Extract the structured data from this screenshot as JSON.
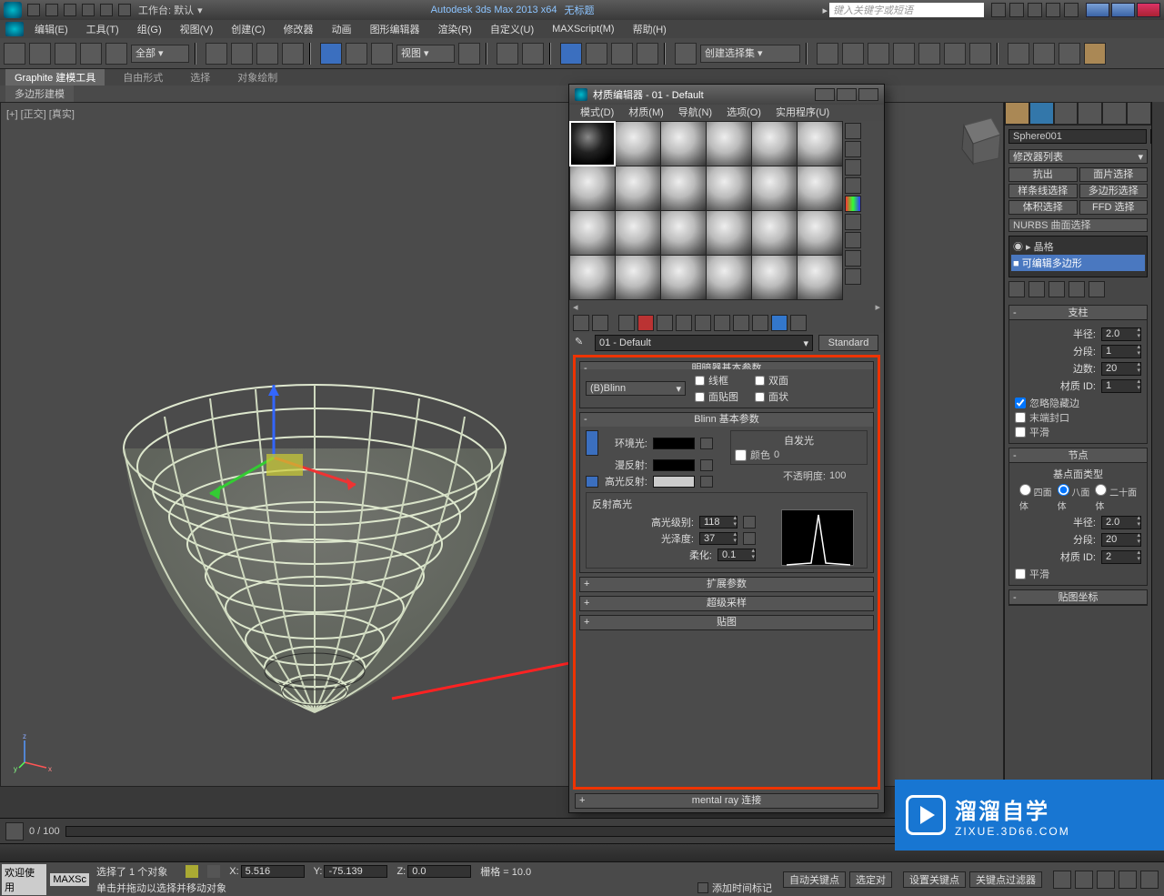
{
  "titlebar": {
    "workspace_label": "工作台: 默认",
    "app_title": "Autodesk 3ds Max  2013 x64",
    "doc_title": "无标题",
    "search_placeholder": "键入关键字或短语"
  },
  "menubar": {
    "items": [
      "编辑(E)",
      "工具(T)",
      "组(G)",
      "视图(V)",
      "创建(C)",
      "修改器",
      "动画",
      "图形编辑器",
      "渲染(R)",
      "自定义(U)",
      "MAXScript(M)",
      "帮助(H)"
    ]
  },
  "toolbar": {
    "selection_set": "全部",
    "view_name": "视图",
    "named_sel": "创建选择集"
  },
  "ribbon": {
    "tabs": [
      "Graphite 建模工具",
      "自由形式",
      "选择",
      "对象绘制"
    ],
    "sub": "多边形建模"
  },
  "viewport": {
    "label": "[+] [正交] [真实]"
  },
  "material_editor": {
    "title": "材质编辑器 - 01 - Default",
    "menu": [
      "模式(D)",
      "材质(M)",
      "导航(N)",
      "选项(O)",
      "实用程序(U)"
    ],
    "mat_name": "01 - Default",
    "type_btn": "Standard",
    "rollout_shader_title": "明暗器基本参数",
    "shader_name": "(B)Blinn",
    "checks": {
      "wire": "线框",
      "twoSided": "双面",
      "faceMap": "面贴图",
      "faceted": "面状"
    },
    "rollout_blinn_title": "Blinn 基本参数",
    "labels": {
      "ambient": "环境光:",
      "diffuse": "漫反射:",
      "specular": "高光反射:",
      "selfillum_group": "自发光",
      "selfillum_color": "颜色",
      "selfillum_val": "0",
      "opacity": "不透明度:",
      "opacity_val": "100"
    },
    "spec_group": "反射高光",
    "spec": {
      "level_lbl": "高光级别:",
      "level_val": "118",
      "gloss_lbl": "光泽度:",
      "gloss_val": "37",
      "soften_lbl": "柔化:",
      "soften_val": "0.1"
    },
    "rollout_extended": "扩展参数",
    "rollout_supersample": "超级采样",
    "rollout_maps": "贴图",
    "rollout_mentalray": "mental ray 连接"
  },
  "modify_panel": {
    "obj_name": "Sphere001",
    "modifier_list": "修改器列表",
    "btns": [
      "抗出",
      "面片选择",
      "样条线选择",
      "多边形选择",
      "体积选择",
      "FFD 选择"
    ],
    "nurbs": "NURBS 曲面选择",
    "stack": {
      "top": "晶格",
      "sub": "可编辑多边形"
    },
    "rollout_strut": {
      "title": "支柱",
      "radius": "半径:",
      "radius_v": "2.0",
      "segs": "分段:",
      "segs_v": "1",
      "sides": "边数:",
      "sides_v": "20",
      "matid": "材质 ID:",
      "matid_v": "1",
      "ignore_hidden": "忽略隐藏边",
      "end_caps": "末端封口",
      "smooth": "平滑"
    },
    "rollout_node": {
      "title": "节点",
      "base_type": "基点面类型",
      "opt4": "四面\n体",
      "opt8": "八面\n体",
      "opt20": "二十面\n体",
      "radius": "半径:",
      "radius_v": "2.0",
      "segs": "分段:",
      "segs_v": "20",
      "matid": "材质 ID:",
      "matid_v": "2",
      "smooth": "平滑"
    },
    "rollout_maps": "贴图坐标"
  },
  "timeline": {
    "frame_info": "0 / 100"
  },
  "statusbar": {
    "welcome1": "欢迎使用",
    "welcome2": "MAXSc",
    "selected": "选择了 1 个对象",
    "prompt": "单击并拖动以选择并移动对象",
    "x": "5.516",
    "y": "-75.139",
    "z": "0.0",
    "grid": "栅格 = 10.0",
    "add_time_tag": "添加时间标记",
    "autokey": "自动关键点",
    "selected_btn": "选定对",
    "setkey": "设置关键点",
    "key_filters": "关键点过滤器"
  },
  "watermark": {
    "cn": "溜溜自学",
    "en": "ZIXUE.3D66.COM"
  }
}
